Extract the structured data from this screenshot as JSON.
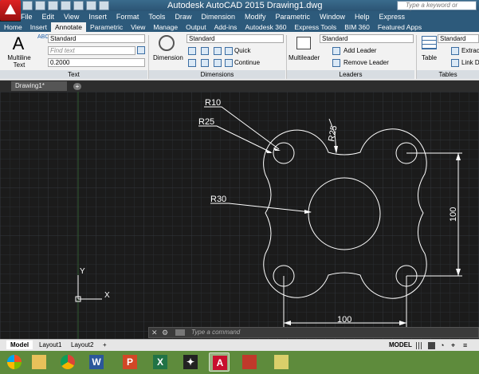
{
  "window": {
    "title": "Autodesk AutoCAD 2015    Drawing1.dwg",
    "search_placeholder": "Type a keyword or phrase"
  },
  "menu": [
    "File",
    "Edit",
    "View",
    "Insert",
    "Format",
    "Tools",
    "Draw",
    "Dimension",
    "Modify",
    "Parametric",
    "Window",
    "Help",
    "Express"
  ],
  "ribbon_tabs": [
    "Home",
    "Insert",
    "Annotate",
    "Parametric",
    "View",
    "Manage",
    "Output",
    "Add-ins",
    "Autodesk 360",
    "Express Tools",
    "BIM 360",
    "Featured Apps"
  ],
  "active_ribbon_tab": "Annotate",
  "text_panel": {
    "big_button": "Multiline\nText",
    "style_value": "Standard",
    "find_placeholder": "Find text",
    "height_value": "0.2000",
    "title": "Text"
  },
  "dimensions_panel": {
    "big_button": "Dimension",
    "style_value": "Standard",
    "quick_label": "Quick",
    "continue_label": "Continue",
    "title": "Dimensions"
  },
  "leaders_panel": {
    "big_button": "Multileader",
    "style_value": "Standard",
    "add_leader": "Add Leader",
    "remove_leader": "Remove Leader",
    "title": "Leaders"
  },
  "tables_panel": {
    "big_button": "Table",
    "style_value": "Standard",
    "extract": "Extract",
    "link": "Link D",
    "title": "Tables"
  },
  "file_tab": "Drawing1*",
  "drawing": {
    "labels": {
      "r10": "R10",
      "r25_left": "R25",
      "r25_top": "R25",
      "r30": "R30",
      "dim_vertical": "100",
      "dim_horizontal": "100"
    },
    "ucs": {
      "x": "X",
      "y": "Y"
    }
  },
  "command": {
    "placeholder": "Type a command"
  },
  "layout_tabs": [
    "Model",
    "Layout1",
    "Layout2"
  ],
  "status": {
    "model": "MODEL"
  },
  "colors": {
    "canvas": "#1b1b1b",
    "lines": "#ffffff",
    "taskbar": "#5e8b3c",
    "title": "#2d5a7b"
  },
  "taskbar_icons": [
    "file-explorer-icon",
    "chrome-icon",
    "firefox-icon",
    "word-icon",
    "powerpoint-icon",
    "excel-icon",
    "autodesk-app-icon",
    "autocad-icon",
    "book-icon",
    "notes-icon"
  ]
}
